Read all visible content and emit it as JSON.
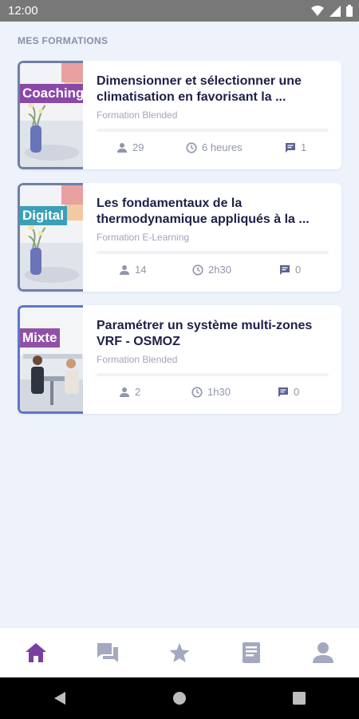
{
  "status_bar": {
    "time": "12:00"
  },
  "section_title": "MES FORMATIONS",
  "courses": [
    {
      "tag": "Coaching",
      "tag_color": "#8b48a8",
      "title": "Dimensionner et sélectionner une climatisation en favorisant la ...",
      "type": "Formation Blended",
      "learners": "29",
      "duration": "6 heures",
      "comments": "1"
    },
    {
      "tag": "Digital",
      "tag_color": "#3aa0b8",
      "title": "Les fondamentaux de la thermodynamique appliqués à la ...",
      "type": "Formation E-Learning",
      "learners": "14",
      "duration": "2h30",
      "comments": "0"
    },
    {
      "tag": "Mixte",
      "tag_color": "#9150a8",
      "title": "Paramétrer un système multi-zones VRF - OSMOZ",
      "type": "Formation Blended",
      "learners": "2",
      "duration": "1h30",
      "comments": "0"
    }
  ],
  "bottom_nav": {
    "items": [
      "home-icon",
      "chat-icon",
      "star-icon",
      "book-icon",
      "profile-icon"
    ],
    "active_color": "#7b3fa0",
    "inactive_color": "#a3a9bf"
  }
}
